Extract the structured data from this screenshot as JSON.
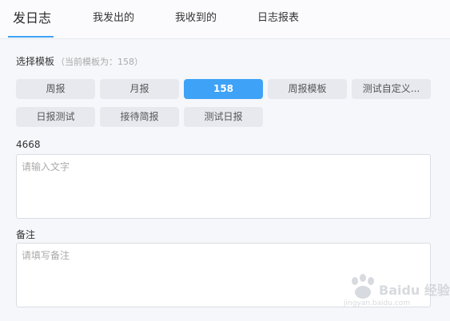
{
  "tabs": [
    {
      "label": "发日志"
    },
    {
      "label": "我发出的"
    },
    {
      "label": "我收到的"
    },
    {
      "label": "日志报表"
    }
  ],
  "template": {
    "label": "选择模板",
    "hint": "（当前模板为：158）"
  },
  "template_buttons": [
    {
      "label": "周报"
    },
    {
      "label": "月报"
    },
    {
      "label": "158"
    },
    {
      "label": "周报模板"
    },
    {
      "label": "测试自定义..."
    },
    {
      "label": "日报测试"
    },
    {
      "label": "接待简报"
    },
    {
      "label": "测试日报"
    }
  ],
  "fields": {
    "field1": {
      "label": "4668",
      "value": "",
      "placeholder": "请输入文字"
    },
    "remark": {
      "label": "备注",
      "value": "",
      "placeholder": "请填写备注"
    }
  },
  "watermark": {
    "text": "Baidu 经验",
    "sub": "jingyan.baidu.com"
  },
  "colors": {
    "accent": "#3ea2f7",
    "button_bg": "#e7e9ee"
  }
}
